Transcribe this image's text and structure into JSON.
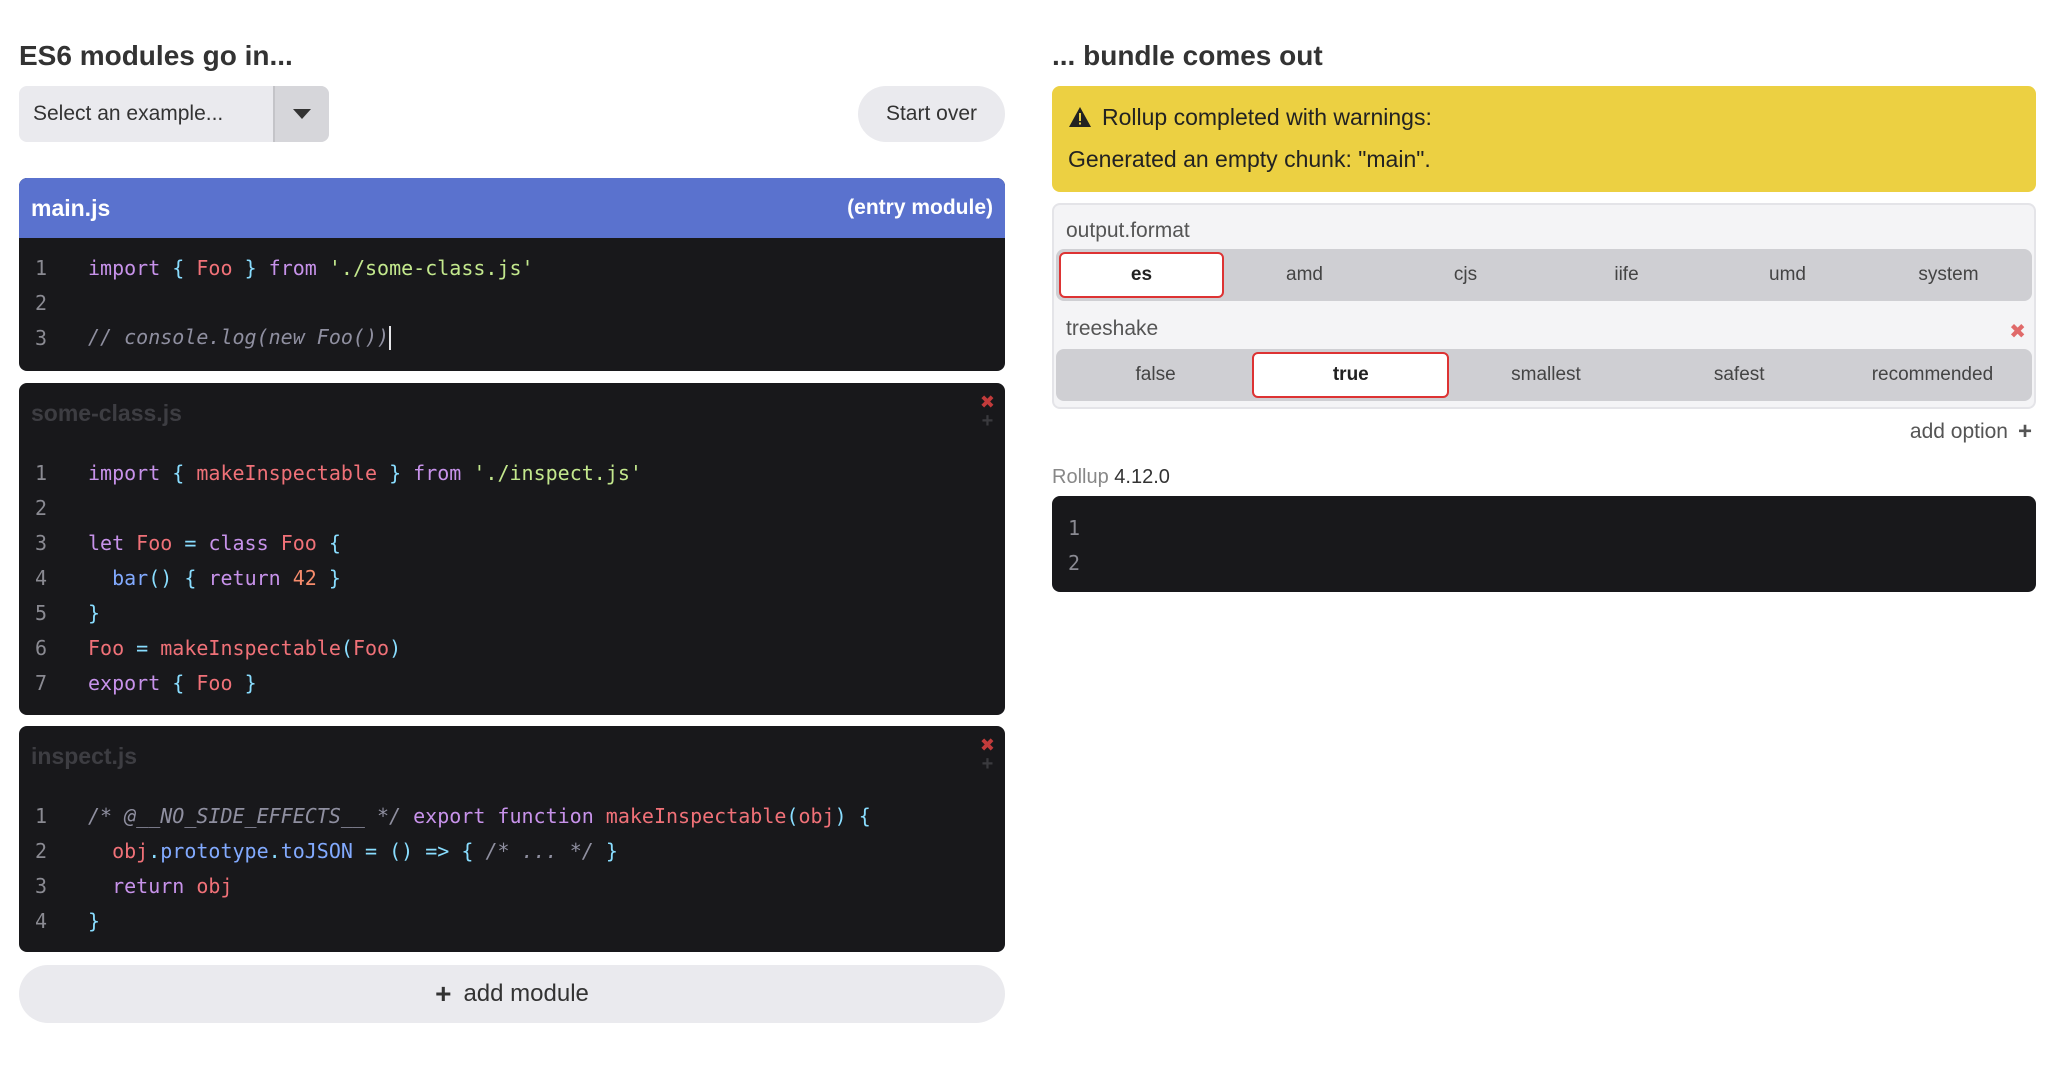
{
  "left": {
    "heading": "ES6 modules go in...",
    "select_placeholder": "Select an example...",
    "start_over": "Start over",
    "add_module": "add module",
    "modules": [
      {
        "name": "main.js",
        "tag": "(entry module)",
        "line_numbers": [
          "1",
          "2",
          "3"
        ]
      },
      {
        "name": "some-class.js",
        "line_numbers": [
          "1",
          "2",
          "3",
          "4",
          "5",
          "6",
          "7"
        ]
      },
      {
        "name": "inspect.js",
        "line_numbers": [
          "1",
          "2",
          "3",
          "4"
        ]
      }
    ]
  },
  "right": {
    "heading": "... bundle comes out",
    "warning_title": "Rollup completed with warnings:",
    "warning_message": "Generated an empty chunk: \"main\".",
    "format_label": "output.format",
    "format_options": [
      "es",
      "amd",
      "cjs",
      "iife",
      "umd",
      "system"
    ],
    "format_selected": "es",
    "treeshake_label": "treeshake",
    "treeshake_options": [
      "false",
      "true",
      "smallest",
      "safest",
      "recommended"
    ],
    "treeshake_selected": "true",
    "add_option": "add option",
    "version_label": "Rollup",
    "version_number": "4.12.0",
    "output_line_numbers": [
      "1",
      "2"
    ]
  },
  "colors": {
    "entry_header": "#5a72ce",
    "warning_bg": "#ecd042",
    "editor_bg": "#18181b",
    "active_border": "#dd3333"
  }
}
